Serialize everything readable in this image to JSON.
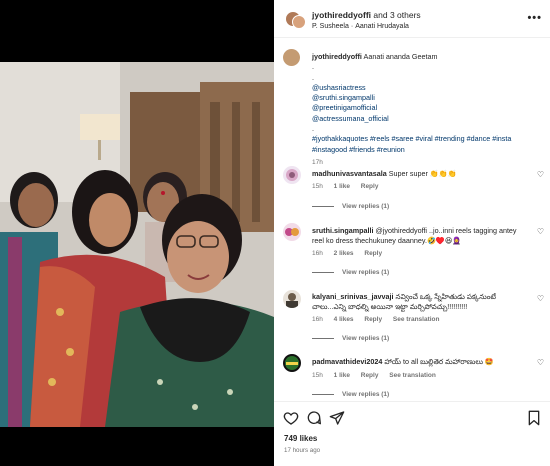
{
  "header": {
    "username": "jyothireddyoffi",
    "and_others": "and 3 others",
    "subtitle_user": "P. Susheela",
    "subtitle_dot": "·",
    "subtitle_audio": "Aanati Hrudayala",
    "more_icon": "more-horizontal-icon"
  },
  "caption": {
    "username": "jyothireddyoffi",
    "text": "Aanati ananda Geetam",
    "dot1": ".",
    "dot2": ".",
    "mentions": [
      "@ushasriactress",
      "@sruthi.singampalli",
      "@preetinigamofficial",
      "@actressumana_official"
    ],
    "dot3": ".",
    "hashtags": "#jyothakkaquotes #reels #saree #viral #trending #dance #insta #instagood #friends #reunion",
    "time": "17h"
  },
  "comments": [
    {
      "username": "madhunivasvantasala",
      "text": "Super super 👏👏👏",
      "time": "15h",
      "likes": "1 like",
      "reply": "Reply",
      "view_replies": "View replies (1)",
      "avatar_color": "#e7d3e9"
    },
    {
      "username": "sruthi.singampalli",
      "text": "@jyothireddyoffi ..jo..inni reels tagging antey reel ko dress thechukuney daanney.🤣♥️😆🧕",
      "time": "16h",
      "likes": "2 likes",
      "reply": "Reply",
      "view_replies": "View replies (1)",
      "avatar_color": "#c24a8a"
    },
    {
      "username": "kalyani_srinivas_javvaji",
      "text": "నవ్వించే ఒక్క స్నేహితుడు పక్కనుంటే చాలు...ఎన్ని బాధల్ని అయినా ఇట్టా మర్చిపోవచ్చు!!!!!!!!!!",
      "time": "16h",
      "likes": "4 likes",
      "reply": "Reply",
      "translation": "See translation",
      "view_replies": "View replies (1)",
      "avatar_color": "#6b5b4a"
    },
    {
      "username": "padmavathidevi2024",
      "text": "హాయ్ to all బుల్లితెర మహారాణులు 🤩",
      "time": "15h",
      "likes": "1 like",
      "reply": "Reply",
      "translation": "See translation",
      "view_replies": "View replies (1)",
      "avatar_color": "#2a6f2a"
    }
  ],
  "actions": {
    "like_icon": "heart-icon",
    "comment_icon": "comment-icon",
    "share_icon": "share-icon",
    "save_icon": "bookmark-icon"
  },
  "stats": {
    "likes": "749 likes",
    "ago": "17 hours ago"
  },
  "colors": {
    "link": "#00376b",
    "muted": "#737373",
    "text": "#262626"
  }
}
